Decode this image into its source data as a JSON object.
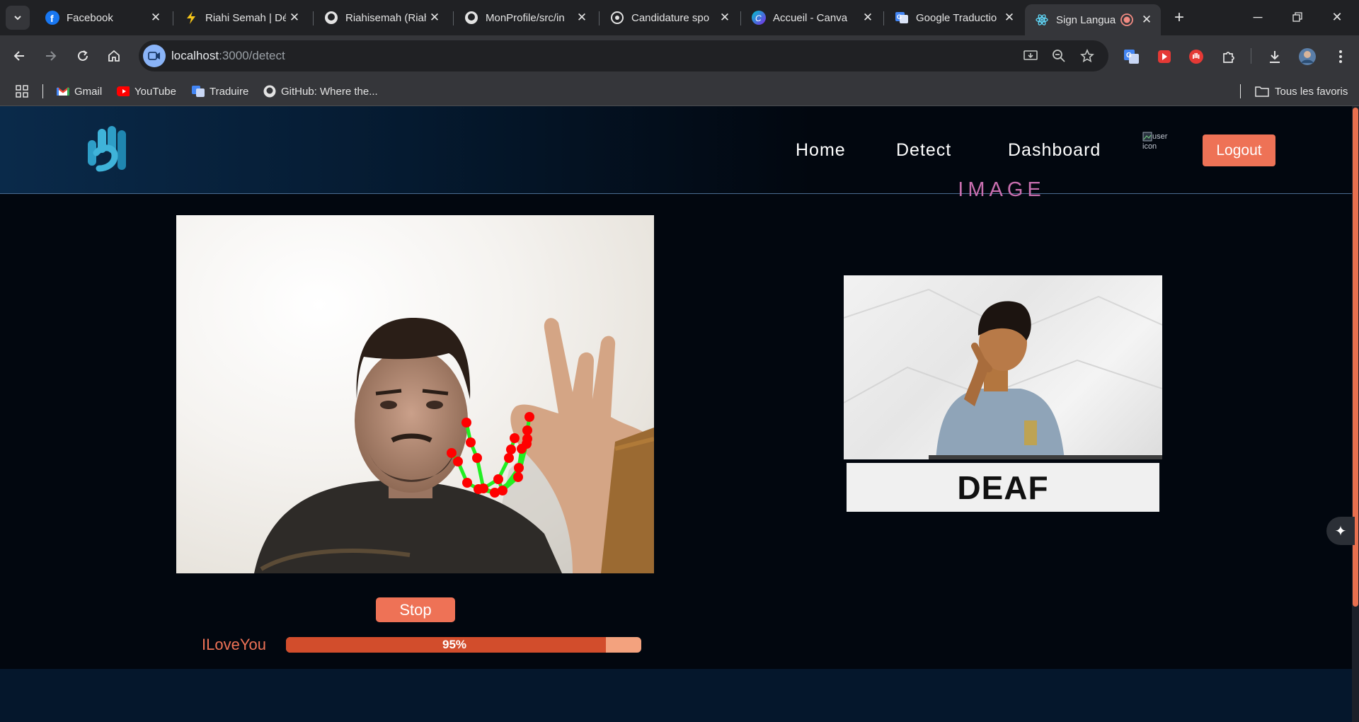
{
  "browser": {
    "tabs": [
      {
        "title": "Facebook",
        "icon": "facebook-icon"
      },
      {
        "title": "Riahi Semah | Dé",
        "icon": "bolt-icon"
      },
      {
        "title": "Riahisemah (Riah",
        "icon": "github-icon"
      },
      {
        "title": "MonProfile/src/in",
        "icon": "github-icon"
      },
      {
        "title": "Candidature spo",
        "icon": "openai-icon"
      },
      {
        "title": "Accueil - Canva",
        "icon": "canva-icon"
      },
      {
        "title": "Google Traductio",
        "icon": "google-translate-icon"
      },
      {
        "title": "Sign Langua",
        "icon": "react-icon",
        "active": true
      }
    ],
    "url_host": "localhost",
    "url_path": ":3000/detect",
    "bookmarks": [
      {
        "label": "Gmail",
        "icon": "gmail-icon"
      },
      {
        "label": "YouTube",
        "icon": "youtube-icon"
      },
      {
        "label": "Traduire",
        "icon": "google-translate-icon"
      },
      {
        "label": "GitHub: Where the...",
        "icon": "github-icon"
      }
    ],
    "all_bookmarks_label": "Tous les favoris"
  },
  "nav": {
    "links": [
      "Home",
      "Detect",
      "Dashboard"
    ],
    "avatar_alt": "user icon",
    "logout_label": "Logout"
  },
  "detect": {
    "stop_label": "Stop",
    "prediction": "ILoveYou",
    "confidence": 95,
    "confidence_text": "95%"
  },
  "reference": {
    "title": "IMAGE",
    "sign_word": "DEAF"
  },
  "colors": {
    "accent": "#ee7256",
    "title_pink": "#c96fb0",
    "landmark": "#ff0000",
    "connection": "#22ee22"
  }
}
